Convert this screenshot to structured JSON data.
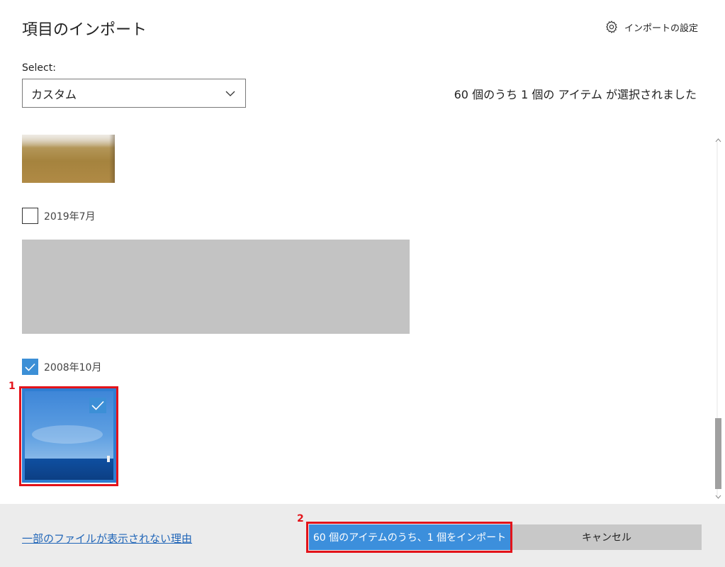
{
  "header": {
    "title": "項目のインポート",
    "settings_label": "インポートの設定",
    "settings_icon": "gear-icon"
  },
  "filter": {
    "label": "Select:",
    "selected_value": "カスタム",
    "dropdown_icon": "chevron-down-icon"
  },
  "selection_status": "60 個のうち 1 個の アイテム が選択されました",
  "groups": [
    {
      "label": "2019年7月",
      "checked": false
    },
    {
      "label": "2008年10月",
      "checked": true
    }
  ],
  "photo": {
    "selected": true
  },
  "annotations": {
    "marker1": "1",
    "marker2": "2",
    "color": "#e3131a"
  },
  "footer": {
    "help_link": "一部のファイルが表示されない理由",
    "import_button": "60 個のアイテムのうち、1 個をインポート",
    "cancel_button": "キャンセル"
  },
  "colors": {
    "accent": "#3c8fdc",
    "link": "#2166b8",
    "footer_bg": "#ececec"
  }
}
